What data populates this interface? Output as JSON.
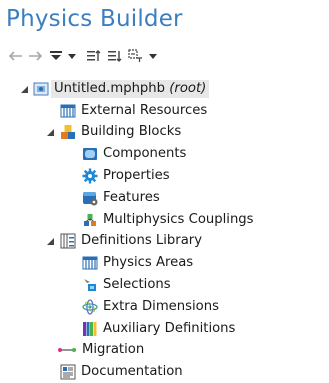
{
  "app": {
    "title": "Physics Builder"
  },
  "toolbar": {
    "items": [
      {
        "icon": "undo-arrow-icon"
      },
      {
        "icon": "redo-arrow-icon"
      },
      {
        "icon": "show-hide-icon"
      },
      {
        "icon": "sort-ascending-icon"
      },
      {
        "icon": "sort-descending-icon"
      },
      {
        "icon": "expand-collapse-icon"
      }
    ]
  },
  "tree": {
    "root": {
      "label": "Untitled.mphphb",
      "suffix": "(root)"
    },
    "external_resources": {
      "label": "External Resources"
    },
    "building_blocks": {
      "label": "Building Blocks",
      "children": [
        {
          "label": "Components"
        },
        {
          "label": "Properties"
        },
        {
          "label": "Features"
        },
        {
          "label": "Multiphysics Couplings"
        }
      ]
    },
    "definitions_library": {
      "label": "Definitions Library",
      "children": [
        {
          "label": "Physics Areas"
        },
        {
          "label": "Selections"
        },
        {
          "label": "Extra Dimensions"
        },
        {
          "label": "Auxiliary Definitions"
        }
      ]
    },
    "migration": {
      "label": "Migration"
    },
    "documentation": {
      "label": "Documentation"
    }
  },
  "colors": {
    "title": "#3b7fc0",
    "selection": "#e7e7e7",
    "icon_blue": "#2a6fb5"
  }
}
